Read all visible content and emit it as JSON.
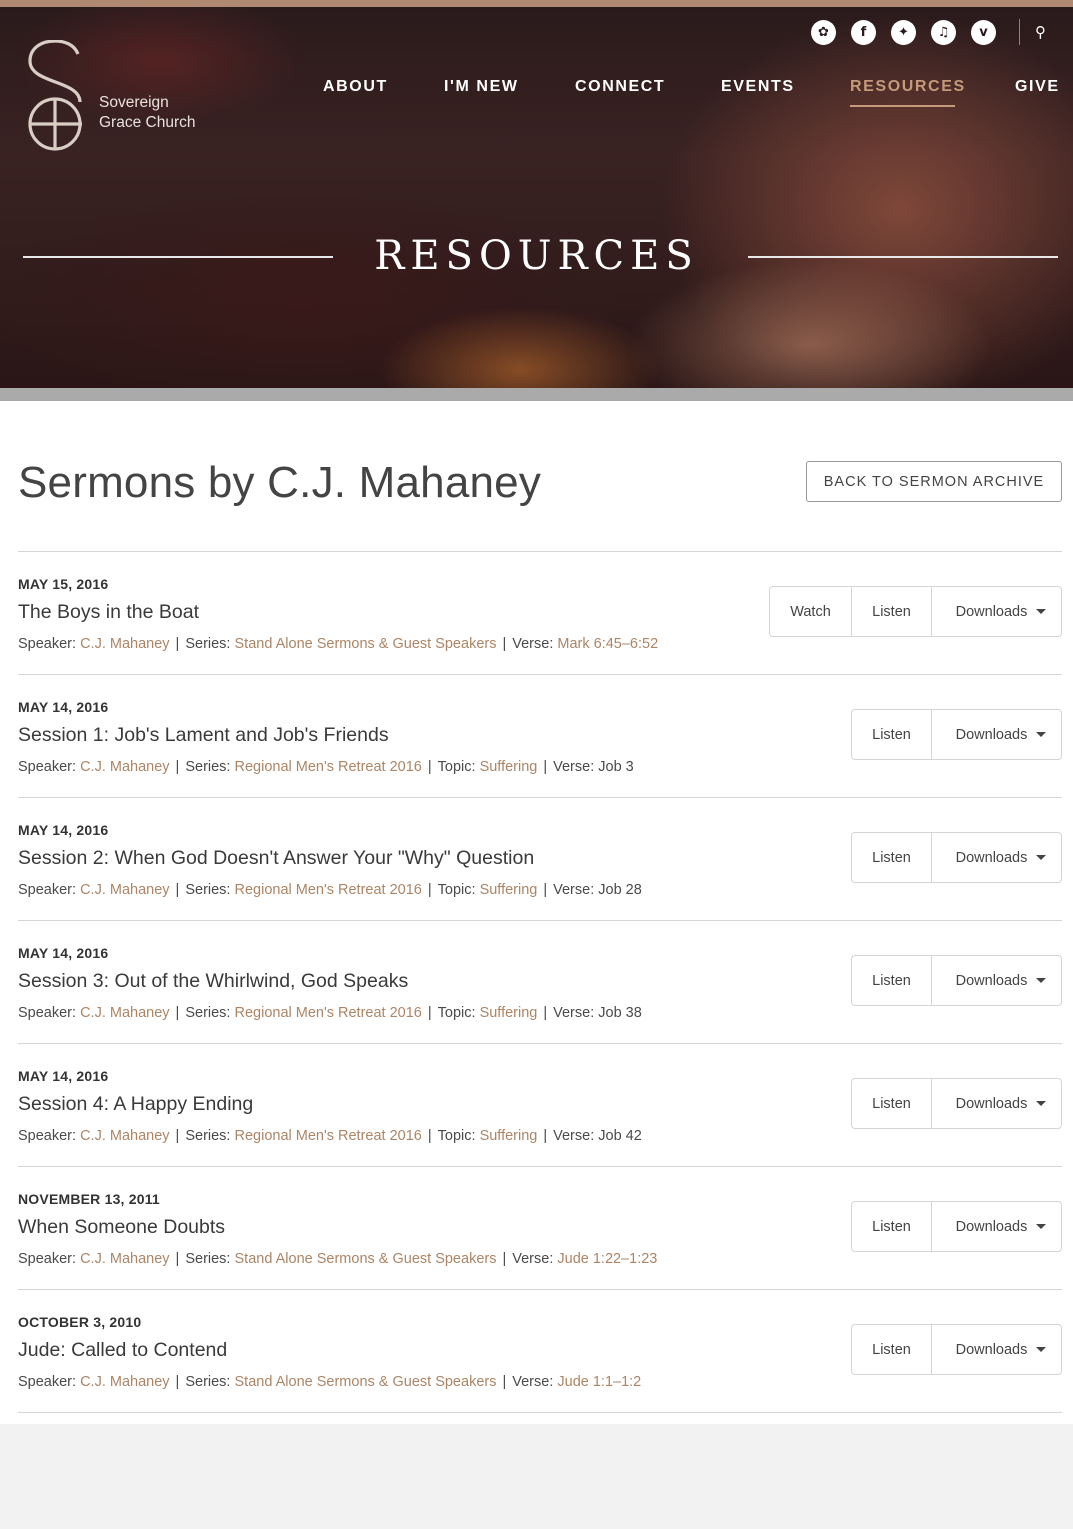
{
  "header": {
    "logo_name_line1": "Sovereign",
    "logo_name_line2": "Grace Church",
    "social": [
      {
        "icon": "sgc-network-icon",
        "glyph": "✿"
      },
      {
        "icon": "facebook-icon",
        "glyph": "f"
      },
      {
        "icon": "twitter-icon",
        "glyph": "✦"
      },
      {
        "icon": "music-icon",
        "glyph": "♫"
      },
      {
        "icon": "vimeo-icon",
        "glyph": "v"
      }
    ],
    "search_icon": "search-icon",
    "search_glyph": "⚲",
    "nav": [
      "ABOUT",
      "I'M NEW",
      "CONNECT",
      "EVENTS",
      "RESOURCES",
      "GIVE"
    ],
    "nav_active": "RESOURCES"
  },
  "hero": {
    "title": "RESOURCES"
  },
  "main": {
    "title": "Sermons by C.J. Mahaney",
    "back_button": "BACK TO SERMON ARCHIVE"
  },
  "labels": {
    "watch": "Watch",
    "listen": "Listen",
    "downloads": "Downloads",
    "speaker": "Speaker:",
    "series": "Series:",
    "topic": "Topic:",
    "verse": "Verse:"
  },
  "sermons": [
    {
      "date": "MAY 15, 2016",
      "title": "The Boys in the Boat",
      "speaker": "C.J. Mahaney",
      "series": "Stand Alone Sermons & Guest Speakers",
      "topic": null,
      "verse": "Mark 6:45–6:52",
      "verse_link": true,
      "watch": true
    },
    {
      "date": "MAY 14, 2016",
      "title": "Session 1: Job's Lament and Job's Friends",
      "speaker": "C.J. Mahaney",
      "series": "Regional Men's Retreat 2016",
      "topic": "Suffering",
      "verse": "Job 3",
      "verse_link": false,
      "watch": false
    },
    {
      "date": "MAY 14, 2016",
      "title": "Session 2: When God Doesn't Answer Your \"Why\" Question",
      "speaker": "C.J. Mahaney",
      "series": "Regional Men's Retreat 2016",
      "topic": "Suffering",
      "verse": "Job 28",
      "verse_link": false,
      "watch": false
    },
    {
      "date": "MAY 14, 2016",
      "title": "Session 3: Out of the Whirlwind, God Speaks",
      "speaker": "C.J. Mahaney",
      "series": "Regional Men's Retreat 2016",
      "topic": "Suffering",
      "verse": "Job 38",
      "verse_link": false,
      "watch": false
    },
    {
      "date": "MAY 14, 2016",
      "title": "Session 4: A Happy Ending",
      "speaker": "C.J. Mahaney",
      "series": "Regional Men's Retreat 2016",
      "topic": "Suffering",
      "verse": "Job 42",
      "verse_link": false,
      "watch": false
    },
    {
      "date": "NOVEMBER 13, 2011",
      "title": "When Someone Doubts",
      "speaker": "C.J. Mahaney",
      "series": "Stand Alone Sermons & Guest Speakers",
      "topic": null,
      "verse": "Jude 1:22–1:23",
      "verse_link": true,
      "watch": false
    },
    {
      "date": "OCTOBER 3, 2010",
      "title": "Jude: Called to Contend",
      "speaker": "C.J. Mahaney",
      "series": "Stand Alone Sermons & Guest Speakers",
      "topic": null,
      "verse": "Jude 1:1–1:2",
      "verse_link": true,
      "watch": false
    }
  ],
  "colors": {
    "accent": "#ad8565",
    "nav_active": "#c49a7b",
    "hero_topline": "#b08a70"
  }
}
